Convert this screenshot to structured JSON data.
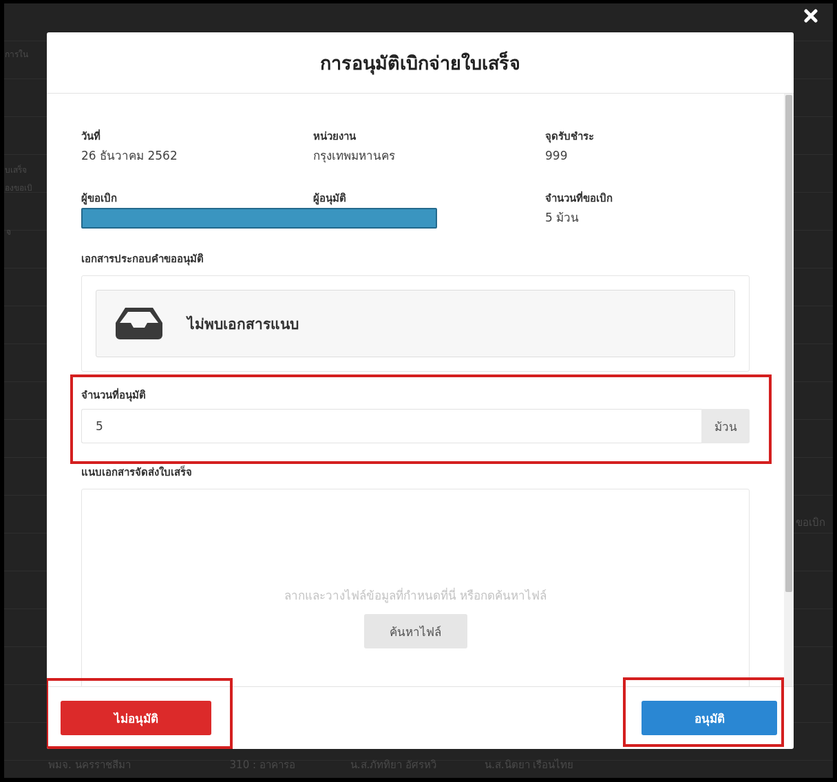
{
  "background_page": {
    "texts": [
      {
        "text": "การใน"
      },
      {
        "text": "บเสร็จ"
      },
      {
        "text": "องขอเบิ"
      },
      {
        "text": "จ"
      },
      {
        "text": "ขอเบิก"
      }
    ],
    "bottom_row": [
      "พมจ. นครราชสีมา",
      "310 : อาคารอ",
      "น.ส.ภัททิยา อัศรหวิ",
      "น.ส.นิตยา เรือนไทย"
    ]
  },
  "modal": {
    "title": "การอนุมัติเบิกจ่ายใบเสร็จ",
    "rows": [
      {
        "cells": [
          {
            "label": "วันที่",
            "kind": "text",
            "value": "26 ธันวาคม 2562"
          },
          {
            "label": "หน่วยงาน",
            "kind": "text",
            "value": "กรุงเทพมหานคร"
          },
          {
            "label": "จุดรับชำระ",
            "kind": "text",
            "value": "999"
          }
        ]
      },
      {
        "cells": [
          {
            "label": "ผู้ขอเบิก",
            "kind": "redacted"
          },
          {
            "label": "ผู้อนุมัติ",
            "kind": "redacted"
          },
          {
            "label": "จำนวนที่ขอเบิก",
            "kind": "text",
            "value": "5 ม้วน"
          }
        ]
      }
    ],
    "attachments": {
      "label": "เอกสารประกอบคำขออนุมัติ",
      "empty_text": "ไม่พบเอกสารแนบ"
    },
    "approved_quantity": {
      "label": "จำนวนที่อนุมัติ",
      "value": "5",
      "unit": "ม้วน",
      "highlighted": true
    },
    "upload": {
      "label": "แนบเอกสารจัดส่งใบเสร็จ",
      "hint": "ลากและวางไฟล์ข้อมูลที่กำหนดที่นี่ หรือกดค้นหาไฟล์",
      "button": "ค้นหาไฟล์"
    },
    "buttons": [
      {
        "label": "ไม่อนุมัติ",
        "kind": "danger",
        "highlighted": true
      },
      {
        "label": "อนุมัติ",
        "kind": "primary",
        "highlighted": true
      }
    ]
  }
}
